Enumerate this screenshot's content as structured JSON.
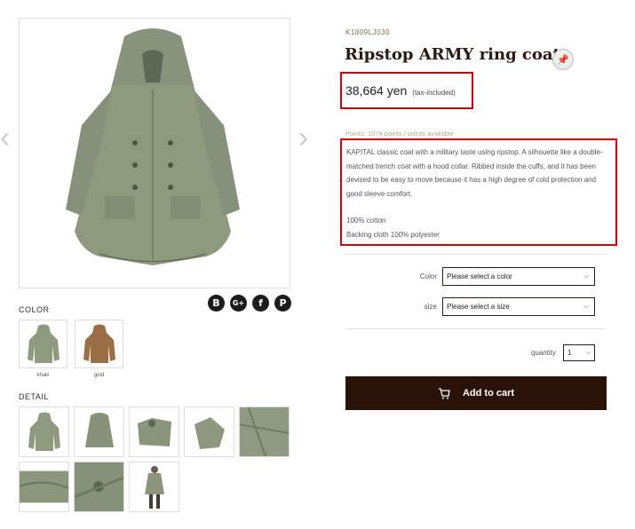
{
  "gallery": {
    "color_label": "COLOR",
    "detail_label": "DETAIL",
    "colors": [
      {
        "name": "khaki",
        "fill": "#8e9a7e"
      },
      {
        "name": "gold",
        "fill": "#9a6f45"
      }
    ],
    "thumb_fill": "#8f9a80",
    "share_icons": [
      "blogger-icon",
      "googleplus-icon",
      "facebook-icon",
      "pinterest-icon"
    ]
  },
  "product": {
    "sku": "K1809LJ030",
    "title": "Ripstop ARMY ring coat",
    "price": "38,664 yen",
    "tax": "(tax-included)",
    "points": "Points: 1074 points / points available",
    "description": "KAPITAL classic coat with a military taste using ripstop. A silhouette like a double-matched trench coat with a hood collar. Ribbed inside the cuffs, and it has been devised to be easy to move because it has a high degree of cold protection and good sleeve comfort.",
    "material1": "100% cotton",
    "material2": "Backing cloth 100% polyester"
  },
  "options": {
    "color_label": "Color",
    "color_value": "Please select a color",
    "size_label": "size",
    "size_value": "Please select a size",
    "quantity_label": "quantity",
    "quantity_value": "1"
  },
  "cart": {
    "label": "Add to cart"
  },
  "colors": {
    "accent": "#2a1208",
    "highlight": "#e00000",
    "coat": "#8e9a7e"
  }
}
